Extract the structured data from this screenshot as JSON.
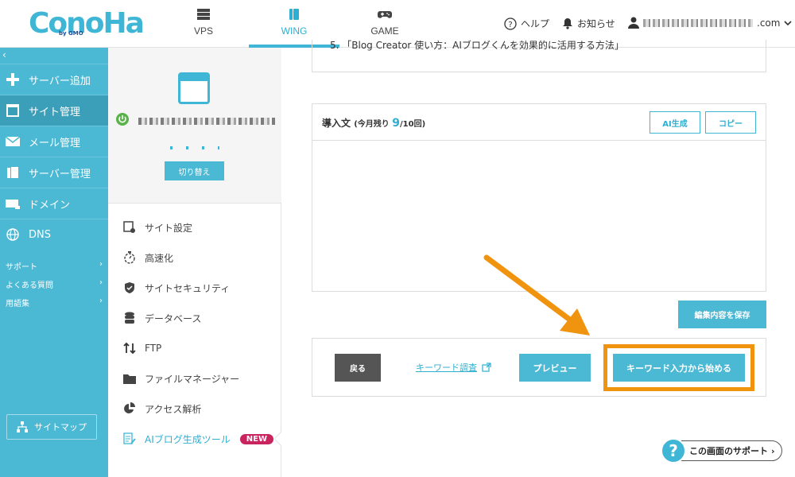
{
  "header": {
    "logo_text": "ConoHa",
    "logo_sub": "by GMO",
    "nav": [
      {
        "label": "VPS",
        "icon": "server-icon"
      },
      {
        "label": "WING",
        "icon": "wing-icon",
        "active": true
      },
      {
        "label": "GAME",
        "icon": "gamepad-icon"
      }
    ],
    "help_label": "ヘルプ",
    "notice_label": "お知らせ",
    "account_suffix": ".com"
  },
  "sidebar": {
    "items": [
      {
        "label": "サーバー追加",
        "icon": "plus-icon"
      },
      {
        "label": "サイト管理",
        "icon": "window-icon",
        "active": true
      },
      {
        "label": "メール管理",
        "icon": "mail-icon"
      },
      {
        "label": "サーバー管理",
        "icon": "server-manage-icon"
      },
      {
        "label": "ドメイン",
        "icon": "domain-icon"
      },
      {
        "label": "DNS",
        "icon": "globe-icon"
      }
    ],
    "links": [
      {
        "label": "サポート"
      },
      {
        "label": "よくある質問"
      },
      {
        "label": "用語集"
      }
    ],
    "sitemap_label": "サイトマップ"
  },
  "site_panel": {
    "switch_label": "切り替え",
    "menu": [
      {
        "label": "サイト設定",
        "icon": "site-settings-icon"
      },
      {
        "label": "高速化",
        "icon": "stopwatch-icon"
      },
      {
        "label": "サイトセキュリティ",
        "icon": "shield-icon"
      },
      {
        "label": "データベース",
        "icon": "database-icon"
      },
      {
        "label": "FTP",
        "icon": "ftp-icon"
      },
      {
        "label": "ファイルマネージャー",
        "icon": "folder-icon"
      },
      {
        "label": "アクセス解析",
        "icon": "pie-chart-icon"
      },
      {
        "label": "AIブログ生成ツール",
        "icon": "ai-blog-icon",
        "current": true,
        "badge": "NEW"
      }
    ]
  },
  "main": {
    "prev_item": "5. 「Blog Creator 使い方：AIブログくんを効果的に活用する方法」",
    "intro": {
      "title": "導入文",
      "remaining_prefix": "(今月残り ",
      "remaining_count": "9",
      "remaining_suffix": "/10回)",
      "ai_button": "AI生成",
      "copy_button": "コピー",
      "text": ""
    },
    "save_button": "編集内容を保存",
    "back_button": "戻る",
    "keyword_research_link": "キーワード調査",
    "preview_button": "プレビュー",
    "keyword_start_button": "キーワード入力から始める",
    "support_button": "この画面のサポート"
  },
  "colors": {
    "accent": "#3fb6d6",
    "sidebar": "#4bb8d4",
    "highlight": "#f0930e",
    "badge": "#c9245d"
  }
}
